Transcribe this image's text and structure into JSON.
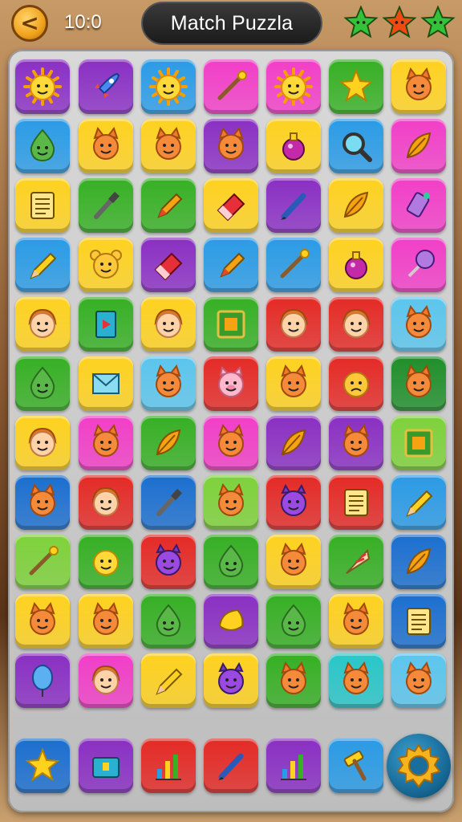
{
  "header": {
    "back_label": "<",
    "timer": "10:0",
    "title": "Match Puzzla",
    "stars": [
      "#33c23a",
      "#f04a12",
      "#33c23a"
    ]
  },
  "palette": {
    "purple": "#8a2fc4",
    "blue": "#2a9be6",
    "pink": "#f23ec8",
    "green": "#36b024",
    "yellow": "#ffd21f",
    "red": "#e52a26",
    "lightblue": "#5bc6ee",
    "darkgreen": "#1f8f2a",
    "navy": "#1b6fd0",
    "lime": "#7ed23a",
    "orange": "#f5a313",
    "teal": "#29c7c9"
  },
  "board": {
    "rows": [
      [
        {
          "bg": "purple",
          "icon": "sun-face"
        },
        {
          "bg": "purple",
          "icon": "rocket"
        },
        {
          "bg": "blue",
          "icon": "sun-face"
        },
        {
          "bg": "pink",
          "icon": "wand"
        },
        {
          "bg": "pink",
          "icon": "sun-face"
        },
        {
          "bg": "green",
          "icon": "star"
        },
        {
          "bg": "yellow",
          "icon": "cat-face"
        }
      ],
      [
        {
          "bg": "blue",
          "icon": "slime-face"
        },
        {
          "bg": "yellow",
          "icon": "cat-face"
        },
        {
          "bg": "yellow",
          "icon": "cat-face"
        },
        {
          "bg": "purple",
          "icon": "cat-face"
        },
        {
          "bg": "yellow",
          "icon": "potion"
        },
        {
          "bg": "blue",
          "icon": "magnifier"
        },
        {
          "bg": "pink",
          "icon": "feather"
        }
      ],
      [
        {
          "bg": "yellow",
          "icon": "notepad"
        },
        {
          "bg": "green",
          "icon": "brush"
        },
        {
          "bg": "green",
          "icon": "crayon"
        },
        {
          "bg": "yellow",
          "icon": "eraser"
        },
        {
          "bg": "purple",
          "icon": "pen"
        },
        {
          "bg": "yellow",
          "icon": "feather"
        },
        {
          "bg": "pink",
          "icon": "tube"
        }
      ],
      [
        {
          "bg": "blue",
          "icon": "pencil"
        },
        {
          "bg": "yellow",
          "icon": "bear-face"
        },
        {
          "bg": "purple",
          "icon": "eraser"
        },
        {
          "bg": "blue",
          "icon": "crayon"
        },
        {
          "bg": "blue",
          "icon": "wand"
        },
        {
          "bg": "yellow",
          "icon": "potion"
        },
        {
          "bg": "pink",
          "icon": "lollipop"
        }
      ],
      [
        {
          "bg": "yellow",
          "icon": "kid-face"
        },
        {
          "bg": "green",
          "icon": "book"
        },
        {
          "bg": "yellow",
          "icon": "kid-face"
        },
        {
          "bg": "green",
          "icon": "frame"
        },
        {
          "bg": "red",
          "icon": "kid-face"
        },
        {
          "bg": "red",
          "icon": "kid-face"
        },
        {
          "bg": "lightblue",
          "icon": "cat-face"
        }
      ],
      [
        {
          "bg": "green",
          "icon": "slime-face"
        },
        {
          "bg": "yellow",
          "icon": "envelope"
        },
        {
          "bg": "lightblue",
          "icon": "cat-face"
        },
        {
          "bg": "red",
          "icon": "pig-face"
        },
        {
          "bg": "yellow",
          "icon": "cat-face"
        },
        {
          "bg": "red",
          "icon": "sad-face"
        },
        {
          "bg": "darkgreen",
          "icon": "cat-face"
        }
      ],
      [
        {
          "bg": "yellow",
          "icon": "kid-face"
        },
        {
          "bg": "pink",
          "icon": "cat-face"
        },
        {
          "bg": "green",
          "icon": "feather"
        },
        {
          "bg": "pink",
          "icon": "cat-face"
        },
        {
          "bg": "purple",
          "icon": "feather"
        },
        {
          "bg": "purple",
          "icon": "cat-face"
        },
        {
          "bg": "lime",
          "icon": "frame"
        }
      ],
      [
        {
          "bg": "navy",
          "icon": "cat-face"
        },
        {
          "bg": "red",
          "icon": "kid-face"
        },
        {
          "bg": "navy",
          "icon": "brush"
        },
        {
          "bg": "lime",
          "icon": "cat-face"
        },
        {
          "bg": "red",
          "icon": "monster-face"
        },
        {
          "bg": "red",
          "icon": "notepad"
        },
        {
          "bg": "blue",
          "icon": "pencil"
        }
      ],
      [
        {
          "bg": "lime",
          "icon": "wand"
        },
        {
          "bg": "green",
          "icon": "smile-face"
        },
        {
          "bg": "red",
          "icon": "monster-face"
        },
        {
          "bg": "green",
          "icon": "slime-face"
        },
        {
          "bg": "yellow",
          "icon": "cat-face"
        },
        {
          "bg": "green",
          "icon": "cone"
        },
        {
          "bg": "navy",
          "icon": "feather"
        }
      ],
      [
        {
          "bg": "yellow",
          "icon": "cat-face"
        },
        {
          "bg": "yellow",
          "icon": "cat-face"
        },
        {
          "bg": "green",
          "icon": "slime-face"
        },
        {
          "bg": "purple",
          "icon": "cheese"
        },
        {
          "bg": "green",
          "icon": "slime-face"
        },
        {
          "bg": "yellow",
          "icon": "cat-face"
        },
        {
          "bg": "navy",
          "icon": "notepad"
        }
      ],
      [
        {
          "bg": "purple",
          "icon": "balloon"
        },
        {
          "bg": "pink",
          "icon": "kid-face"
        },
        {
          "bg": "yellow",
          "icon": "pencil"
        },
        {
          "bg": "yellow",
          "icon": "monster-face"
        },
        {
          "bg": "green",
          "icon": "cat-face"
        },
        {
          "bg": "teal",
          "icon": "cat-face"
        },
        {
          "bg": "lightblue",
          "icon": "cat-face"
        }
      ]
    ],
    "bottom_row": [
      {
        "bg": "navy",
        "icon": "star"
      },
      {
        "bg": "purple",
        "icon": "chest"
      },
      {
        "bg": "red",
        "icon": "chart"
      },
      {
        "bg": "red",
        "icon": "pen"
      },
      {
        "bg": "purple",
        "icon": "chart"
      },
      {
        "bg": "blue",
        "icon": "hammer"
      }
    ],
    "settings_icon": "gear-icon"
  }
}
